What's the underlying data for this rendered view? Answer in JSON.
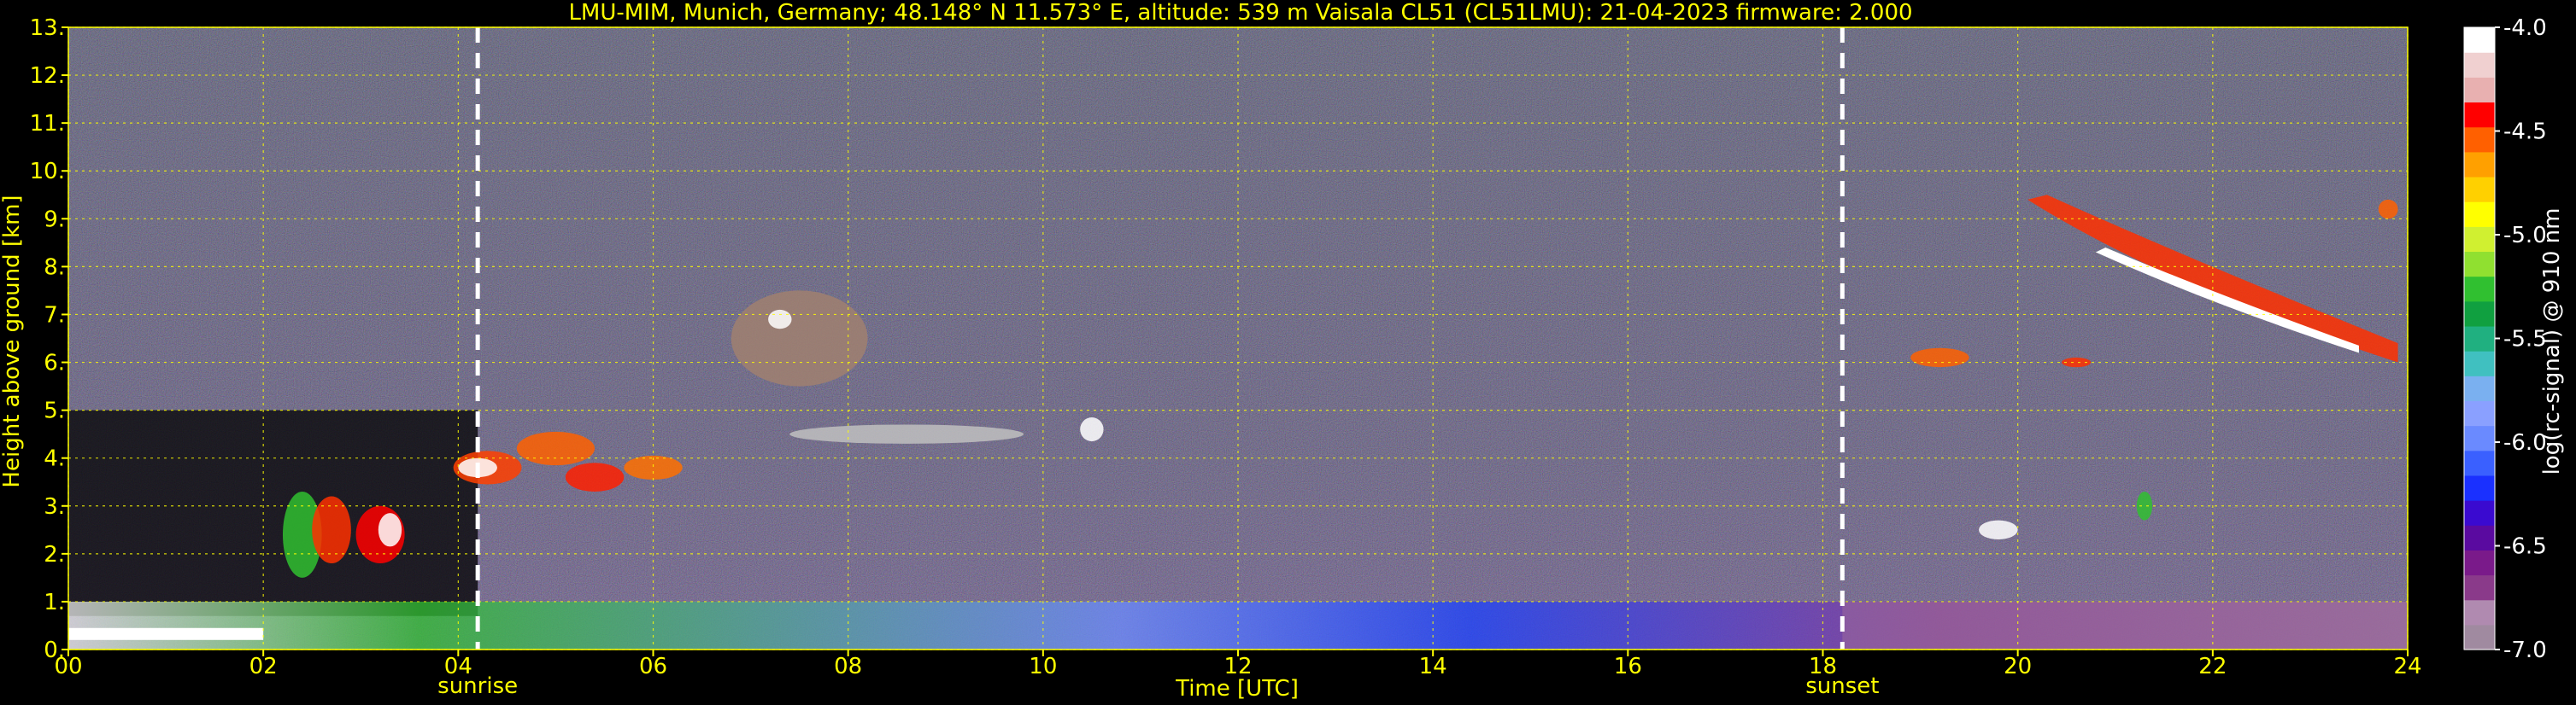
{
  "chart_data": {
    "type": "heatmap",
    "title": "LMU-MIM, Munich, Germany; 48.148° N 11.573° E, altitude: 539 m    Vaisala CL51 (CL51LMU): 21-04-2023    firmware: 2.000",
    "xlabel": "Time [UTC]",
    "ylabel": "Height above ground [km]",
    "xlim": [
      0,
      24
    ],
    "ylim": [
      0,
      13
    ],
    "x_ticks": [
      "00",
      "02",
      "04",
      "06",
      "08",
      "10",
      "12",
      "14",
      "16",
      "18",
      "20",
      "22",
      "24"
    ],
    "y_ticks": [
      "0.",
      "1.",
      "2.",
      "3.",
      "4.",
      "5.",
      "6.",
      "7.",
      "8.",
      "9.",
      "10.",
      "11.",
      "12.",
      "13."
    ],
    "grid": true,
    "colorbar": {
      "label": "log(rc-signal) @ 910 nm",
      "ticks": [
        "-4.0",
        "-4.5",
        "-5.0",
        "-5.5",
        "-6.0",
        "-6.5",
        "-7.0"
      ],
      "range": [
        -7.0,
        -4.0
      ],
      "colors": [
        "#a08aa0",
        "#b08ab0",
        "#8a3a8a",
        "#7a1a8a",
        "#5a0aa0",
        "#3a0ad0",
        "#1a30ff",
        "#3a60ff",
        "#6a8aff",
        "#8aa0ff",
        "#7ab0f0",
        "#40c0c0",
        "#20b080",
        "#10a040",
        "#30c030",
        "#90e030",
        "#d0f030",
        "#ffff00",
        "#ffd000",
        "#ffa000",
        "#ff6000",
        "#ff0000",
        "#e8b0b0",
        "#f0d0d0",
        "#ffffff"
      ]
    },
    "markers": [
      {
        "label": "sunrise",
        "x": 4.2
      },
      {
        "label": "sunset",
        "x": 18.2
      }
    ],
    "features": [
      {
        "name": "boundary layer (surface)",
        "x_range": [
          0,
          24
        ],
        "height": 0.3
      },
      {
        "name": "low cloud cluster",
        "x_range": [
          2.2,
          3.7
        ],
        "height_range": [
          0.8,
          3.4
        ]
      },
      {
        "name": "mid-level cloud",
        "x_range": [
          3.8,
          6.3
        ],
        "height_range": [
          3.4,
          4.8
        ]
      },
      {
        "name": "cirrus",
        "x_range": [
          20.0,
          24.0
        ],
        "height_range": [
          6.0,
          9.5
        ]
      }
    ]
  }
}
